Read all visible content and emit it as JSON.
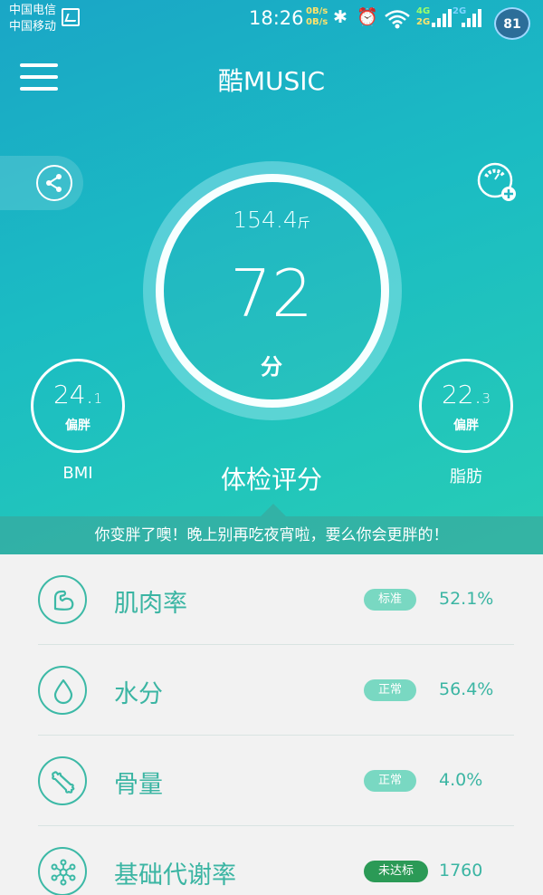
{
  "status_bar": {
    "carrier_1": "中国电信",
    "carrier_2": "中国移动",
    "time": "18:26",
    "speed_up": "0B/s",
    "speed_down": "0B/s",
    "net_4g": "4G",
    "net_2g_a": "2G",
    "net_2g_b": "2G",
    "battery": "81"
  },
  "header": {
    "title": "酷MUSIC"
  },
  "score_panel": {
    "weight_value": "154.4",
    "weight_unit": "斤",
    "score": "72",
    "score_unit": "分",
    "title": "体检评分"
  },
  "bmi": {
    "int": "24.",
    "dec": "1",
    "status": "偏胖",
    "label": "BMI"
  },
  "body_fat": {
    "int": "22.",
    "dec": "3",
    "status": "偏胖",
    "label": "脂肪"
  },
  "notice": "你变胖了噢！晚上别再吃夜宵啦，要么你会更胖的！",
  "metrics": [
    {
      "name": "肌肉率",
      "badge": "标准",
      "value": "52.1%",
      "icon": "muscle-arm-icon"
    },
    {
      "name": "水分",
      "badge": "正常",
      "value": "56.4%",
      "icon": "water-drop-icon"
    },
    {
      "name": "骨量",
      "badge": "正常",
      "value": "4.0%",
      "icon": "bone-icon"
    },
    {
      "name": "基础代谢率",
      "badge": "未达标",
      "value": "1760",
      "icon": "molecule-icon"
    }
  ],
  "colors": {
    "accent": "#3bb5a3",
    "badge_light": "#79d8c2",
    "badge_dark": "#2b9a56"
  }
}
